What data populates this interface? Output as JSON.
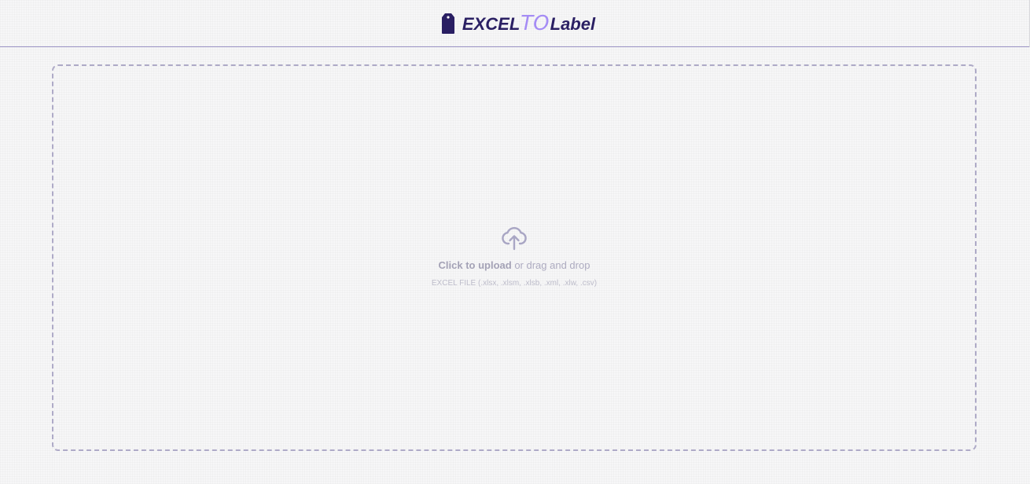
{
  "header": {
    "brand_excel": "EXCEL",
    "brand_to": "TO",
    "brand_label": "Label",
    "logo_icon": "tag-icon"
  },
  "dropzone": {
    "icon": "cloud-upload-icon",
    "click_text": "Click to upload",
    "drag_text": " or drag and drop",
    "formats": "EXCEL FILE (.xlsx, .xlsm, .xlsb, .xml, .xlw, .csv)"
  },
  "colors": {
    "brand_dark": "#2a1f63",
    "brand_accent": "#a58cf5",
    "border_dashed": "#aeaac7",
    "header_rule": "#9a93c4"
  }
}
